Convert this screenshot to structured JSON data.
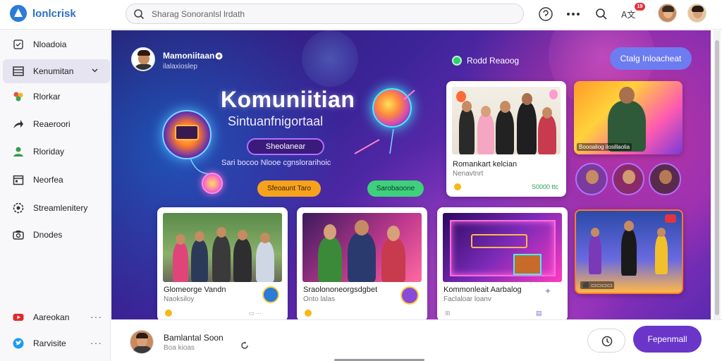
{
  "app": {
    "logo_text": "lonlcrisk"
  },
  "search": {
    "placeholder": "Sharag Sonoranlsl lrdath"
  },
  "header": {
    "notification_count": "19",
    "icons": [
      "chat-icon",
      "more-icon",
      "search-icon",
      "translate-icon",
      "avatar"
    ]
  },
  "sidebar": {
    "items": [
      {
        "label": "Nloadoia",
        "icon": "book-icon"
      },
      {
        "label": "Kenumitan",
        "icon": "list-icon",
        "active": true
      },
      {
        "label": "Rlorkar",
        "icon": "palette-icon"
      },
      {
        "label": "Reaeroori",
        "icon": "share-icon"
      },
      {
        "label": "Rloriday",
        "icon": "person-icon"
      },
      {
        "label": "Neorfea",
        "icon": "calendar-icon"
      },
      {
        "label": "Streamlenitery",
        "icon": "settings-icon"
      },
      {
        "label": "Dnodes",
        "icon": "camera-icon"
      },
      {
        "label": "Aareokan",
        "icon": "youtube-icon"
      },
      {
        "label": "Rarvisite",
        "icon": "twitter-icon"
      }
    ]
  },
  "banner": {
    "host_name": "Mamoniitaan",
    "host_sub": "ilalaxioslep",
    "live_label": "Rodd Reaoog",
    "cta_top": "Ctalg Inloacheat",
    "title": "Komuniitian",
    "subtitle": "Sintuanfnigortaal",
    "pill": "Sheolanear",
    "note": "Sari bocoo  Nlooe cgnslorarihoic",
    "btn_orange": "Sfeoaunt Taro",
    "btn_green": "Sarobaoone"
  },
  "cards": [
    {
      "title": "Glomeorge Vandn",
      "meta": "Naoksiloy"
    },
    {
      "title": "Sraolononeorgsdgbet",
      "meta": "Onto lalas"
    },
    {
      "title": "Kommonleait Aarbalog",
      "meta": "Faclaloar loanv"
    },
    {
      "title": "Romankart kelcian",
      "meta": "Nenavtnrt",
      "price": "S0000 ttc"
    },
    {
      "caption": "Boooaliog ilosillaolia"
    }
  ],
  "footer": {
    "name": "Bamlantal Soon",
    "sub": "Boa kioas",
    "primary_button": "Fepenmall"
  },
  "colors": {
    "accent": "#6a35c9",
    "brand": "#2b7bd8",
    "live": "#2fcf6e",
    "badge": "#e0353d"
  }
}
